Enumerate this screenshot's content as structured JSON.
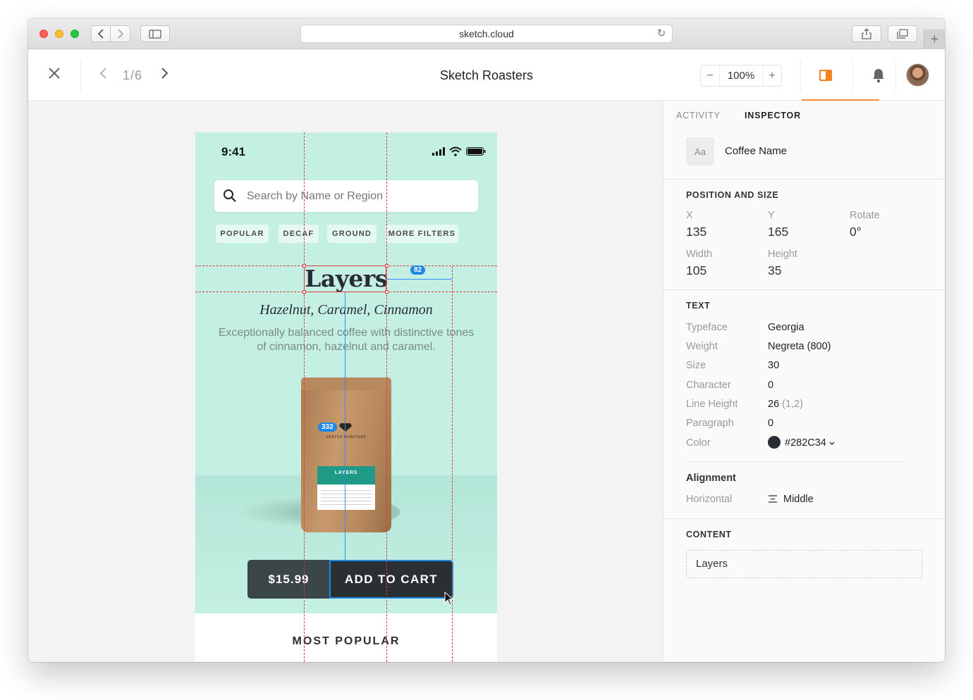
{
  "browser": {
    "url": "sketch.cloud"
  },
  "toolbar": {
    "page_counter": "1/6",
    "document_title": "Sketch Roasters",
    "zoom_minus": "−",
    "zoom_value": "100%",
    "zoom_plus": "+"
  },
  "artboard": {
    "status_time": "9:41",
    "search_placeholder": "Search by Name or Region",
    "chips": [
      "POPULAR",
      "DECAF",
      "GROUND",
      "MORE FILTERS"
    ],
    "title": "Layers",
    "subtitle": "Hazelnut, Caramel, Cinnamon",
    "description": "Exceptionally balanced coffee with distinctive tones of cinnamon, hazelnut and caramel.",
    "bag_brand": "SKETCH ROASTERS",
    "bag_label": "LAYERS",
    "price": "$15.99",
    "add_to_cart": "ADD TO CART",
    "section_heading": "MOST POPULAR",
    "measure_horizontal": "82",
    "measure_vertical": "332"
  },
  "inspector": {
    "tabs": [
      "ACTIVITY",
      "INSPECTOR"
    ],
    "layer_type": "Aa",
    "layer_name": "Coffee Name",
    "position_size": {
      "title": "POSITION AND SIZE",
      "x_label": "X",
      "x_value": "135",
      "y_label": "Y",
      "y_value": "165",
      "rotate_label": "Rotate",
      "rotate_value": "0°",
      "width_label": "Width",
      "width_value": "105",
      "height_label": "Height",
      "height_value": "35"
    },
    "text": {
      "title": "TEXT",
      "rows": [
        {
          "label": "Typeface",
          "value": "Georgia"
        },
        {
          "label": "Weight",
          "value": "Negreta (800)"
        },
        {
          "label": "Size",
          "value": "30"
        },
        {
          "label": "Character",
          "value": "0"
        },
        {
          "label": "Line Height",
          "value": "26",
          "extra": "(1,2)"
        },
        {
          "label": "Paragraph",
          "value": "0"
        },
        {
          "label": "Color",
          "value": "#282C34"
        }
      ]
    },
    "alignment": {
      "title": "Alignment",
      "horizontal_label": "Horizontal",
      "horizontal_value": "Middle"
    },
    "content": {
      "title": "CONTENT",
      "value": "Layers"
    }
  },
  "colors": {
    "accent": "#f5821f",
    "selection": "#e0393e",
    "measure": "#1e88e5",
    "artboard_bg": "#c4f0e3",
    "text_color": "#282c34"
  }
}
